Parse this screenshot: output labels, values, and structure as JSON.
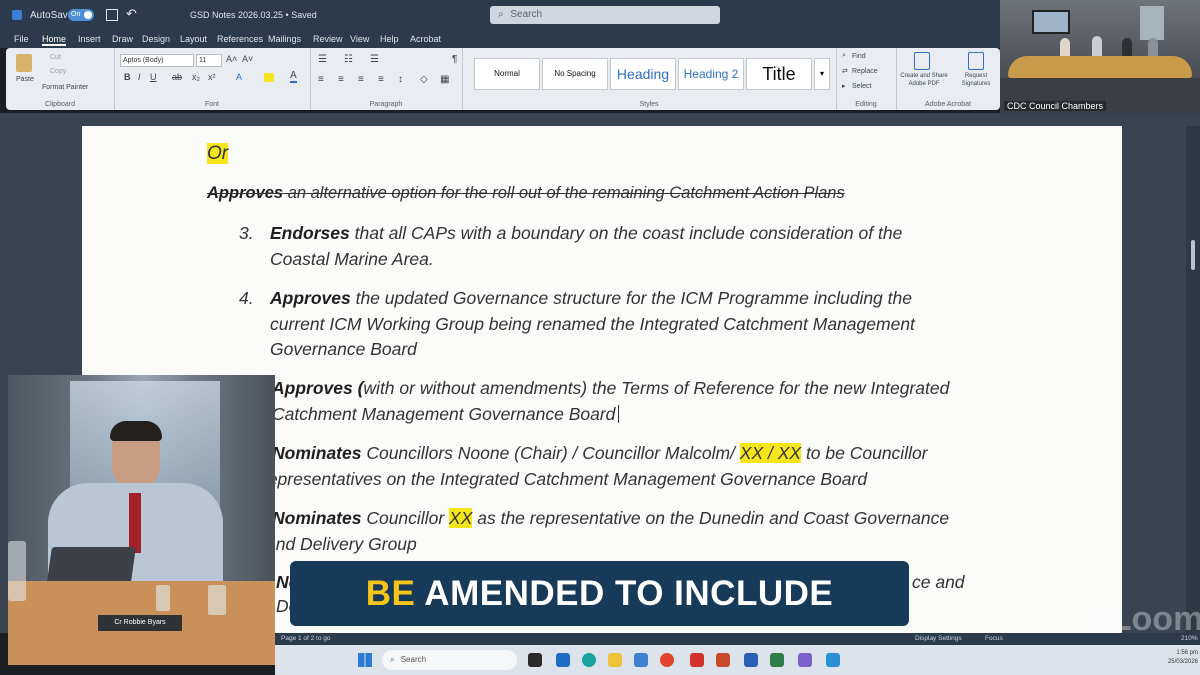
{
  "titlebar": {
    "autosave_label": "AutoSave",
    "toggle_state": "On",
    "doc_title": "GSD Notes 2026.03.25 • Saved",
    "search_placeholder": "Search"
  },
  "menu": {
    "tabs": [
      "File",
      "Home",
      "Insert",
      "Draw",
      "Design",
      "Layout",
      "References",
      "Mailings",
      "Review",
      "View",
      "Help",
      "Acrobat"
    ],
    "active": "Home"
  },
  "ribbon": {
    "clipboard": {
      "paste": "Paste",
      "cut": "Cut",
      "copy": "Copy",
      "format_painter": "Format Painter",
      "label": "Clipboard"
    },
    "font": {
      "name": "Aptos (Body)",
      "size": "11",
      "label": "Font"
    },
    "paragraph": {
      "label": "Paragraph"
    },
    "styles": {
      "items": [
        "Normal",
        "No Spacing",
        "Heading",
        "Heading 2",
        "Title"
      ],
      "label": "Styles"
    },
    "editing": {
      "find": "Find",
      "replace": "Replace",
      "select": "Select",
      "label": "Editing"
    },
    "acrobat": {
      "create": "Create and Share Adobe PDF",
      "request": "Request Signatures",
      "label": "Adobe Acrobat"
    }
  },
  "chamber_label": "CDC Council Chambers",
  "document": {
    "or_text": "Or",
    "strike_bold": "Approves",
    "strike_rest": " an alternative option for the roll out of the remaining Catchment Action Plans",
    "item3": {
      "num": "3.",
      "bold": "Endorses",
      "line1": " that all CAPs with a boundary on the coast include consideration of the",
      "line2": "Coastal Marine Area."
    },
    "item4": {
      "num": "4.",
      "bold": "Approves",
      "line1": " the updated Governance structure for the ICM Programme including the",
      "line2": "current ICM Working Group being renamed the Integrated Catchment Management",
      "line3": "Governance Board"
    },
    "item5": {
      "bold": "Approves",
      "paren": " (",
      "line1": "with or without amendments) the Terms of Reference for the new Integrated",
      "line2": "Catchment Management Governance Board"
    },
    "item6": {
      "bold": "Nominates",
      "line1a": " Councillors Noone (Chair) / Councillor Malcolm/ ",
      "hl": "XX / XX",
      "line1b": "  to be Councillor",
      "line2": "representatives on the Integrated Catchment Management Governance Board"
    },
    "item7": {
      "bold": "Nominates",
      "line1a": " Councillor ",
      "hl": "XX",
      "line1b": " as the representative on the Dunedin and Coast Governance",
      "line2": "and Delivery Group"
    },
    "item8": {
      "bold": "No",
      "line1_tail": "ce and",
      "line2": "De"
    }
  },
  "speaker": {
    "nameplate": "Cr Robbie Byars"
  },
  "caption": {
    "highlight": "BE",
    "rest": " AMENDED TO INCLUDE"
  },
  "statusbar": {
    "left": "Page 1 of 2  to go",
    "display": "Display Settings",
    "focus": "Focus",
    "zoom": "210%"
  },
  "taskbar": {
    "search": "Search",
    "time": "1:56 pm",
    "date": "25/03/2026"
  },
  "watermark": "bLoom",
  "colors": {
    "highlight": "#f7e51b",
    "caption_bg": "#173a59",
    "caption_accent": "#f5c518",
    "ribbon_bg": "#e9edf1",
    "titlebar_bg": "#2b3a4d"
  }
}
